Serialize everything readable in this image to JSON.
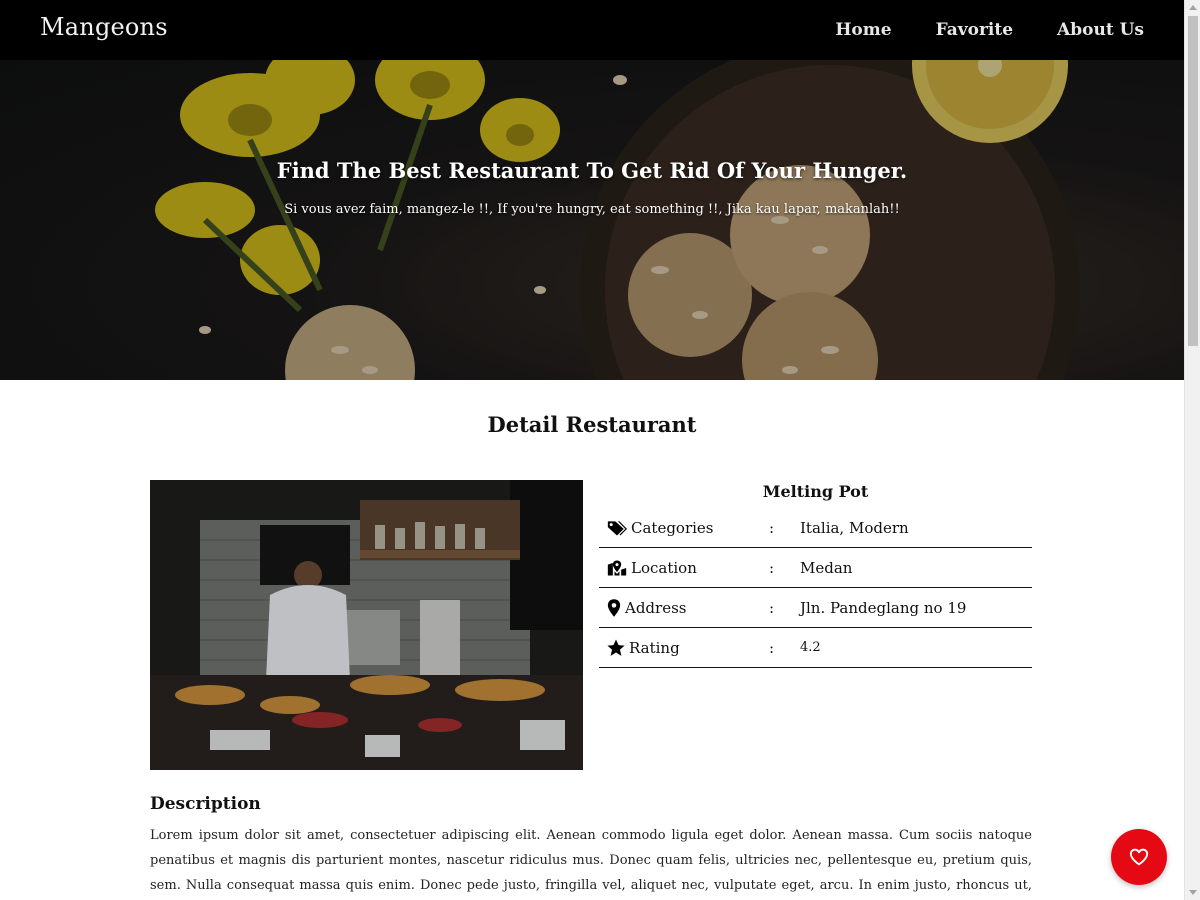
{
  "nav": {
    "brand": "Mangeons",
    "links": [
      {
        "label": "Home"
      },
      {
        "label": "Favorite"
      },
      {
        "label": "About Us"
      }
    ]
  },
  "hero": {
    "title": "Find The Best Restaurant To Get Rid Of Your Hunger.",
    "subtitle": "Si vous avez faim, mangez-le !!, If you're hungry, eat something !!, Jika kau lapar, makanlah!!"
  },
  "detail": {
    "section_title": "Detail Restaurant",
    "name": "Melting Pot",
    "rows": [
      {
        "icon": "tags-icon",
        "label": "Categories",
        "separator": ":",
        "value": "Italia, Modern"
      },
      {
        "icon": "map-location-icon",
        "label": "Location",
        "separator": ":",
        "value": "Medan"
      },
      {
        "icon": "map-pin-icon",
        "label": "Address",
        "separator": ":",
        "value": "Jln. Pandeglang no 19"
      },
      {
        "icon": "star-icon",
        "label": "Rating",
        "separator": ":",
        "value": "4.2"
      }
    ],
    "description_heading": "Description",
    "description": "Lorem ipsum dolor sit amet, consectetuer adipiscing elit. Aenean commodo ligula eget dolor. Aenean massa. Cum sociis natoque penatibus et magnis dis parturient montes, nascetur ridiculus mus. Donec quam felis, ultricies nec, pellentesque eu, pretium quis, sem. Nulla consequat massa quis enim. Donec pede justo, fringilla vel, aliquet nec, vulputate eget, arcu. In enim justo, rhoncus ut, imperdiet a, venenatis vitae, justo."
  },
  "favorite_button": {
    "icon": "heart-icon",
    "color": "#e50914"
  },
  "colors": {
    "navbar": "#000000",
    "accent": "#e50914",
    "text": "#111111"
  }
}
